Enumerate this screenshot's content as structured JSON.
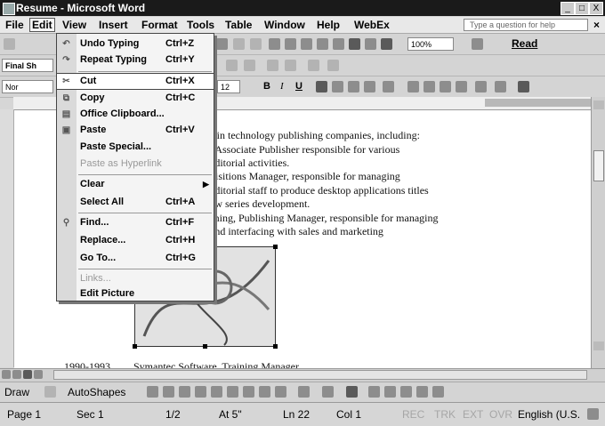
{
  "window": {
    "title": "Resume - Microsoft Word",
    "controls": [
      "_",
      "□",
      "X"
    ]
  },
  "menubar": {
    "items": [
      "File",
      "Edit",
      "View",
      "Insert",
      "Format",
      "Tools",
      "Table",
      "Window",
      "Help",
      "WebEx"
    ],
    "ask_placeholder": "Type a question for help",
    "close": "×"
  },
  "toolbar1": {
    "zoom": "100%",
    "read_label": "Read"
  },
  "toolbar2": {
    "combo": "Final Sh"
  },
  "toolbar3": {
    "style": "Nor",
    "size": "12",
    "bold": "B",
    "italic": "I",
    "underline": "U"
  },
  "edit_menu": {
    "items": [
      {
        "label": "Undo Typing",
        "shortcut": "Ctrl+Z",
        "icon": "undo-icon",
        "glyph": "↶",
        "disabled": false
      },
      {
        "label": "Repeat Typing",
        "shortcut": "Ctrl+Y",
        "icon": "redo-icon",
        "glyph": "↷",
        "disabled": false
      },
      {
        "label": "Cut",
        "shortcut": "Ctrl+X",
        "icon": "scissors-icon",
        "glyph": "✂",
        "disabled": false
      },
      {
        "label": "Copy",
        "shortcut": "Ctrl+C",
        "icon": "copy-icon",
        "glyph": "⧉",
        "disabled": false
      },
      {
        "label": "Office Clipboard...",
        "shortcut": "",
        "icon": "clipboard-icon",
        "glyph": "▤",
        "disabled": false
      },
      {
        "label": "Paste",
        "shortcut": "Ctrl+V",
        "icon": "paste-icon",
        "glyph": "▣",
        "disabled": false
      },
      {
        "label": "Paste Special...",
        "shortcut": "",
        "icon": "",
        "glyph": "",
        "disabled": false
      },
      {
        "label": "Paste as Hyperlink",
        "shortcut": "",
        "icon": "",
        "glyph": "",
        "disabled": true
      },
      {
        "label": "Clear",
        "shortcut": "",
        "icon": "",
        "glyph": "",
        "disabled": false
      },
      {
        "label": "Select All",
        "shortcut": "Ctrl+A",
        "icon": "",
        "glyph": "",
        "disabled": false
      },
      {
        "label": "Find...",
        "shortcut": "Ctrl+F",
        "icon": "binoculars-icon",
        "glyph": "⚲",
        "disabled": false
      },
      {
        "label": "Replace...",
        "shortcut": "Ctrl+H",
        "icon": "",
        "glyph": "",
        "disabled": false
      },
      {
        "label": "Go To...",
        "shortcut": "Ctrl+G",
        "icon": "",
        "glyph": "",
        "disabled": false
      },
      {
        "label": "Links...",
        "shortcut": "",
        "icon": "",
        "glyph": "",
        "disabled": true
      },
      {
        "label": "Edit Picture",
        "shortcut": "",
        "icon": "",
        "glyph": "",
        "disabled": false
      }
    ]
  },
  "document": {
    "lines": [
      "s in technology publishing companies, including:",
      ", Associate Publisher responsible for various",
      "editorial activities.",
      "uisitions Manager, responsible for managing",
      "editorial staff to produce desktop applications titles",
      "ew series development.",
      "shing, Publishing Manager, responsible for managing",
      "and interfacing with sales and marketing"
    ],
    "date": "1990-1993",
    "employer": "Symantec Software, Training Manager"
  },
  "drawbar": {
    "draw": "Draw",
    "autoshapes": "AutoShapes"
  },
  "statusbar": {
    "page": "Page 1",
    "sec": "Sec 1",
    "pages": "1/2",
    "at": "At 5\"",
    "ln": "Ln 22",
    "col": "Col 1",
    "rec": "REC",
    "trk": "TRK",
    "ext": "EXT",
    "ovr": "OVR",
    "lang": "English (U.S."
  }
}
